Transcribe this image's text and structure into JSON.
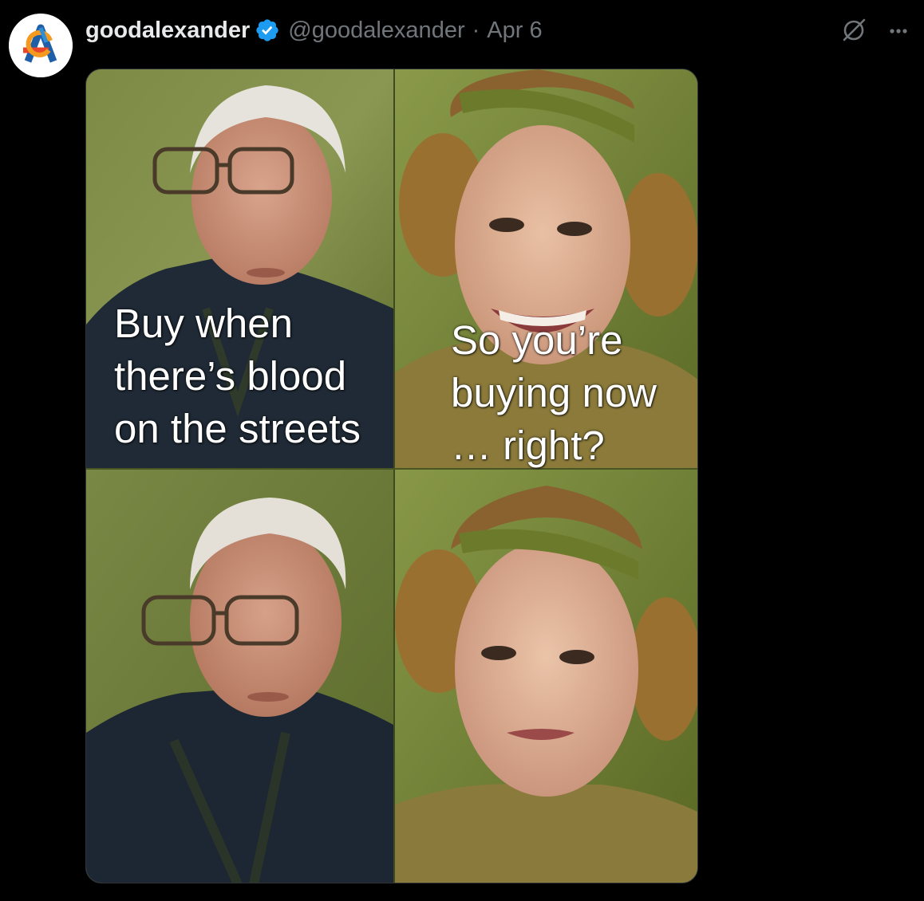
{
  "author": {
    "display_name": "goodalexander",
    "handle": "@goodalexander",
    "separator": "·",
    "date": "Apr 6",
    "verified": true
  },
  "icons": {
    "avatar": "avatar-logo",
    "verified": "verified-badge-icon",
    "grok": "grok-icon",
    "more": "more-options-icon"
  },
  "colors": {
    "background": "#000000",
    "name": "#e7e9ea",
    "secondary": "#71767b",
    "verified": "#1d9bf0"
  },
  "meme": {
    "caption_left": [
      "Buy when",
      "there’s blood",
      "on the streets"
    ],
    "caption_right": [
      "So you’re",
      "buying now",
      "… right?"
    ]
  }
}
